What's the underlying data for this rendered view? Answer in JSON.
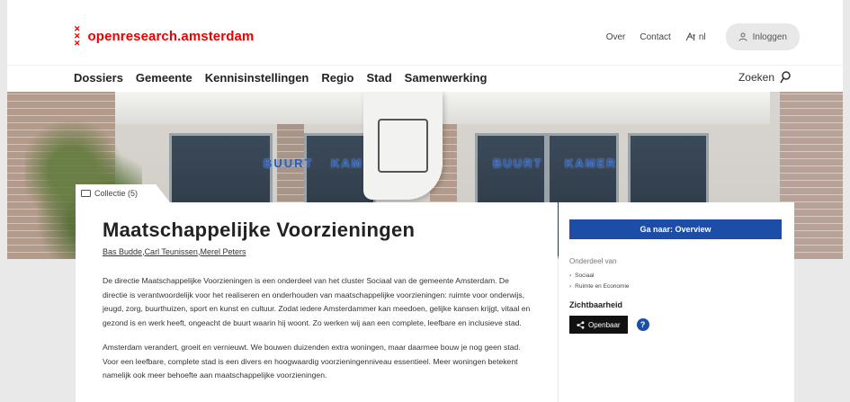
{
  "header": {
    "logo_mark": "xxx",
    "logo_text": "openresearch.amsterdam",
    "links": {
      "about": "Over",
      "contact": "Contact",
      "language": "nl",
      "login": "Inloggen"
    }
  },
  "nav": {
    "items": [
      "Dossiers",
      "Gemeente",
      "Kennisinstellingen",
      "Regio",
      "Stad",
      "Samenwerking"
    ],
    "search_label": "Zoeken"
  },
  "hero": {
    "sign_left_1": "BUURT",
    "sign_left_2": "KAM",
    "sign_right_1": "BUURT",
    "sign_right_2": "KAMER"
  },
  "collection": {
    "label": "Collectie (5)"
  },
  "article": {
    "title": "Maatschappelijke Voorzieningen",
    "authors": [
      "Bas Budde",
      "Carl Teunissen",
      "Merel Peters"
    ],
    "paragraph_1": "De directie Maatschappelijke Voorzieningen is een onderdeel van het cluster Sociaal van de gemeente Amsterdam. De directie is verantwoordelijk voor het realiseren en onderhouden van maatschappelijke voorzieningen: ruimte voor onderwijs, jeugd, zorg, buurthuizen, sport en kunst en cultuur. Zodat iedere Amsterdammer kan meedoen, gelijke kansen krijgt, vitaal en gezond is en werk heeft, ongeacht de buurt waarin hij woont. Zo werken wij aan een complete, leefbare en inclusieve stad.",
    "paragraph_2": "Amsterdam verandert, groeit en vernieuwt. We bouwen duizenden extra woningen, maar daarmee bouw je nog geen stad. Voor een leefbare, complete stad is een divers en hoogwaardig voorzieningenniveau essentieel. Meer woningen betekent namelijk ook meer behoefte aan maatschappelijke voorzieningen."
  },
  "sidebar": {
    "goto_label": "Ga naar: Overview",
    "part_of_label": "Onderdeel van",
    "part_of_items": [
      "Sociaal",
      "Ruimte en Economie"
    ],
    "visibility_label": "Zichtbaarheid",
    "public_label": "Openbaar",
    "help_symbol": "?"
  },
  "colors": {
    "brand_red": "#ec0000",
    "accent_blue": "#1c4ea8"
  }
}
